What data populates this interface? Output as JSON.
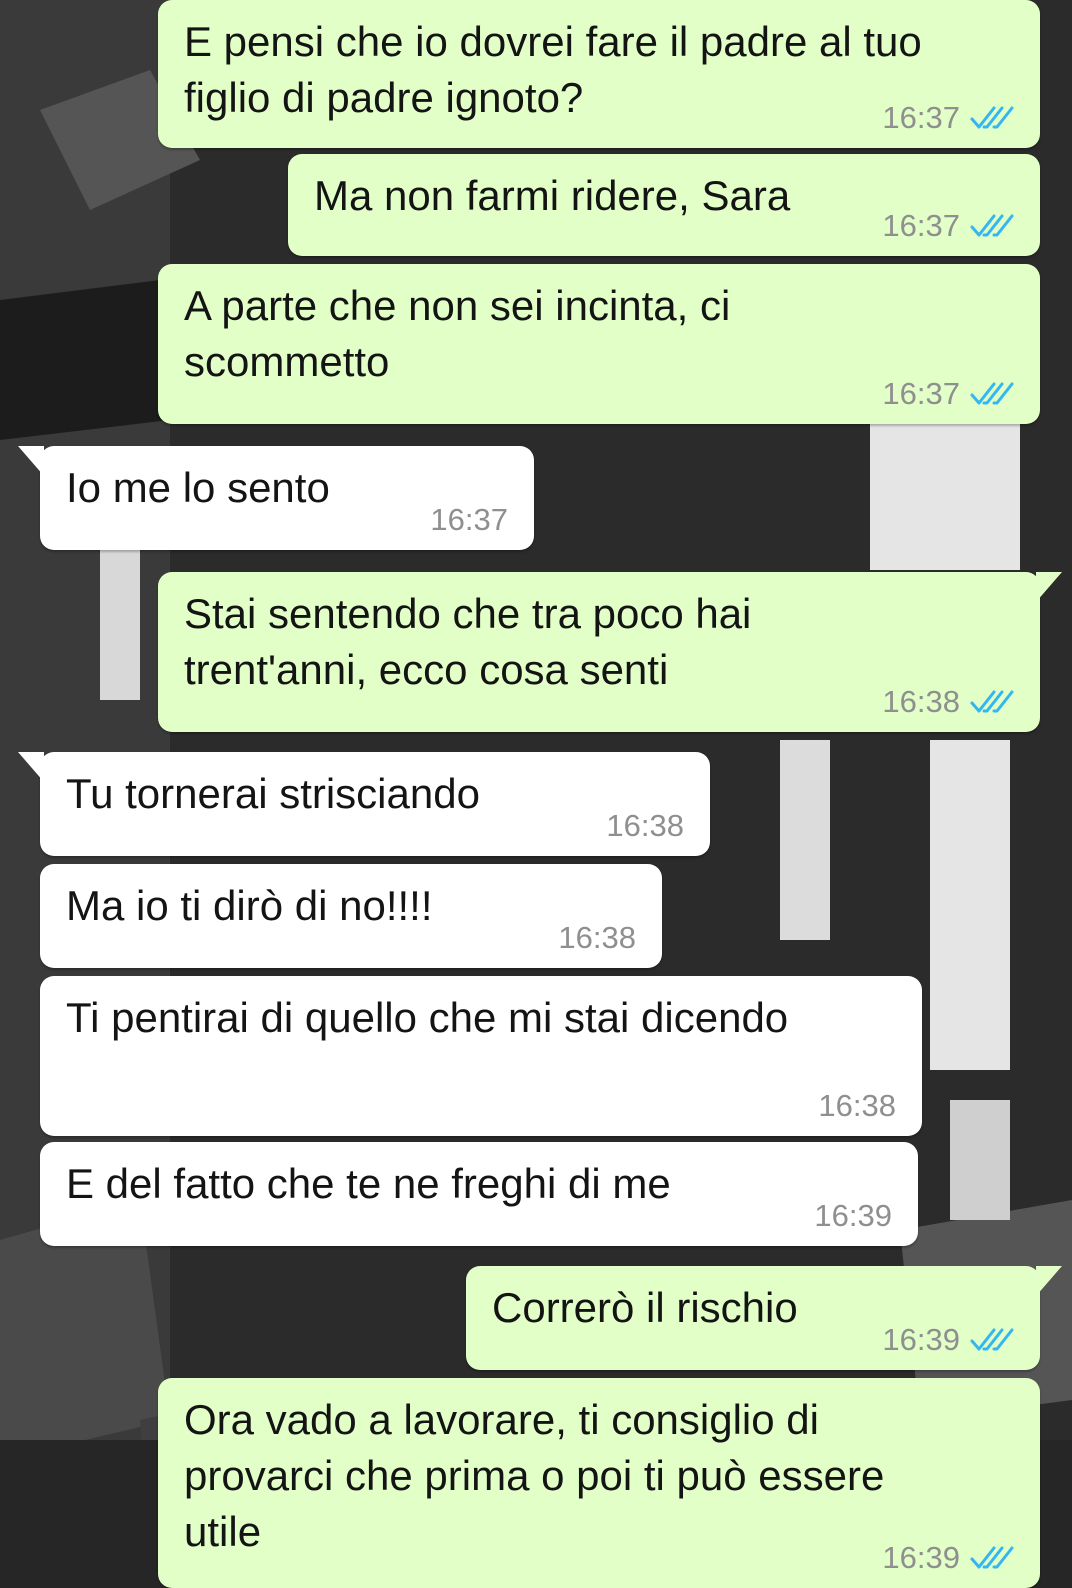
{
  "colors": {
    "outgoing_bubble": "#e1ffc7",
    "incoming_bubble": "#ffffff",
    "read_ticks": "#34b7f1",
    "timestamp": "#8f8f8f"
  },
  "messages": [
    {
      "direction": "out",
      "text": "E pensi che io dovrei fare il padre al tuo\nfiglio di padre ignoto?",
      "time": "16:37",
      "status_icon": "double-check-read-icon"
    },
    {
      "direction": "out",
      "text": "Ma non farmi ridere, Sara",
      "time": "16:37",
      "status_icon": "double-check-read-icon"
    },
    {
      "direction": "out",
      "text": "A parte che non sei incinta, ci\nscommetto",
      "time": "16:37",
      "status_icon": "double-check-read-icon"
    },
    {
      "direction": "in",
      "text": "Io me lo sento",
      "time": "16:37"
    },
    {
      "direction": "out",
      "text": "Stai sentendo che tra poco hai\ntrent'anni, ecco cosa senti",
      "time": "16:38",
      "status_icon": "double-check-read-icon"
    },
    {
      "direction": "in",
      "text": "Tu tornerai strisciando",
      "time": "16:38"
    },
    {
      "direction": "in",
      "text": "Ma io ti dirò di no!!!!",
      "time": "16:38"
    },
    {
      "direction": "in",
      "text": "Ti pentirai di quello che mi stai dicendo",
      "time": "16:38"
    },
    {
      "direction": "in",
      "text": "E del fatto che te ne freghi di me",
      "time": "16:39"
    },
    {
      "direction": "out",
      "text": "Correrò il rischio",
      "time": "16:39",
      "status_icon": "double-check-read-icon"
    },
    {
      "direction": "out",
      "text": "Ora vado a lavorare, ti consiglio di\nprovarci che prima o poi ti può essere\nutile",
      "time": "16:39",
      "status_icon": "double-check-read-icon"
    }
  ]
}
